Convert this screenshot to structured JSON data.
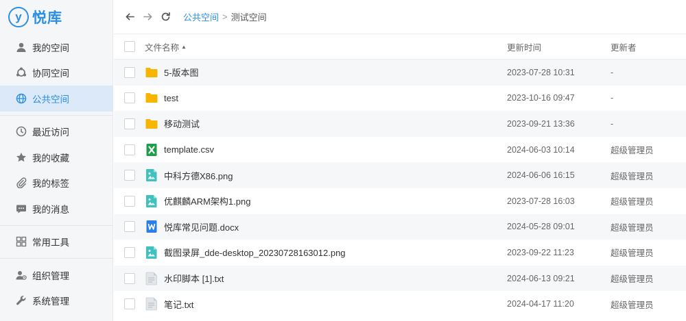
{
  "app": {
    "logo_mark": "y",
    "logo_text": "悦库"
  },
  "sidebar": {
    "items": [
      {
        "label": "我的空间",
        "icon": "user-icon"
      },
      {
        "label": "协同空间",
        "icon": "collab-icon"
      },
      {
        "label": "公共空间",
        "icon": "globe-icon",
        "active": true
      },
      {
        "label": "最近访问",
        "icon": "clock-icon"
      },
      {
        "label": "我的收藏",
        "icon": "star-icon"
      },
      {
        "label": "我的标签",
        "icon": "paperclip-icon"
      },
      {
        "label": "我的消息",
        "icon": "message-icon"
      },
      {
        "label": "常用工具",
        "icon": "grid-icon"
      },
      {
        "label": "组织管理",
        "icon": "org-icon"
      },
      {
        "label": "系统管理",
        "icon": "wrench-icon"
      }
    ]
  },
  "breadcrumb": {
    "parent": "公共空间",
    "separator": ">",
    "current": "测试空间"
  },
  "table": {
    "headers": {
      "name": "文件名称",
      "time": "更新时间",
      "user": "更新者"
    },
    "rows": [
      {
        "name": "5-版本图",
        "type": "folder",
        "time": "2023-07-28 10:31",
        "user": "-"
      },
      {
        "name": "test",
        "type": "folder",
        "time": "2023-10-16 09:47",
        "user": "-"
      },
      {
        "name": "移动测试",
        "type": "folder",
        "time": "2023-09-21 13:36",
        "user": "-"
      },
      {
        "name": "template.csv",
        "type": "excel",
        "time": "2024-06-03 10:14",
        "user": "超级管理员"
      },
      {
        "name": "中科方德X86.png",
        "type": "image",
        "time": "2024-06-06 16:15",
        "user": "超级管理员"
      },
      {
        "name": "优麒麟ARM架构1.png",
        "type": "image",
        "time": "2023-07-28 16:03",
        "user": "超级管理员"
      },
      {
        "name": "悦库常见问题.docx",
        "type": "word",
        "time": "2024-05-28 09:01",
        "user": "超级管理员"
      },
      {
        "name": "截图录屏_dde-desktop_20230728163012.png",
        "type": "image",
        "time": "2023-09-22 11:23",
        "user": "超级管理员"
      },
      {
        "name": "水印脚本 [1].txt",
        "type": "text",
        "time": "2024-06-13 09:21",
        "user": "超级管理员"
      },
      {
        "name": "笔记.txt",
        "type": "text",
        "time": "2024-04-17 11:20",
        "user": "超级管理员"
      }
    ]
  },
  "colors": {
    "accent": "#2b8fe6",
    "folder": "#f7b500",
    "excel": "#1e9e4a",
    "image": "#3fc1c0",
    "word": "#2b7de9",
    "text": "#c9cdd2"
  }
}
